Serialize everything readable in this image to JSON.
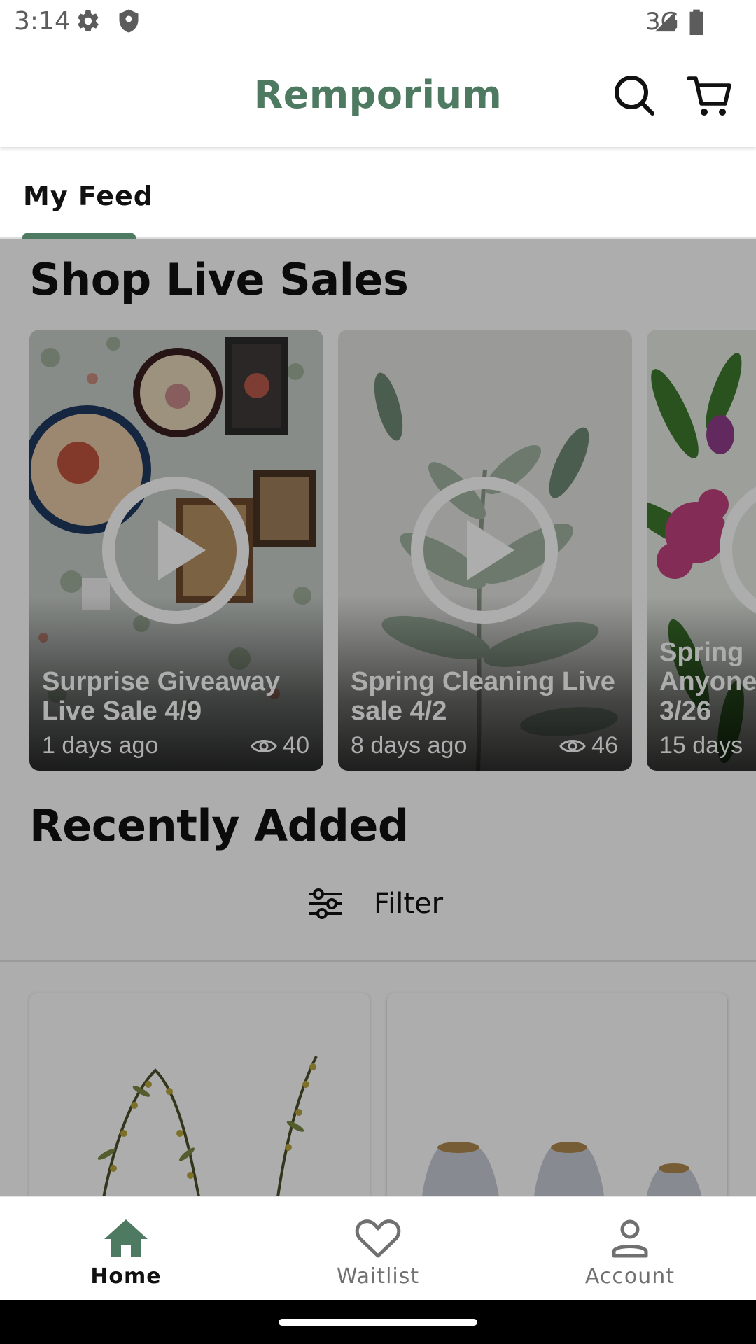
{
  "status_bar": {
    "time": "3:14",
    "network": "3G",
    "icons": [
      "settings-icon",
      "shield-icon",
      "signal-icon",
      "battery-icon"
    ]
  },
  "app_bar": {
    "title": "Remporium",
    "actions": [
      "search-icon",
      "cart-icon"
    ]
  },
  "tabs": [
    {
      "label": "My Feed",
      "selected": true
    }
  ],
  "sections": {
    "live_sales": {
      "title": "Shop Live Sales",
      "cards": [
        {
          "title": "Surprise Giveaway Live Sale 4/9",
          "age": "1 days ago",
          "views": "40"
        },
        {
          "title": "Spring Cleaning Live sale 4/2",
          "age": "8 days ago",
          "views": "46"
        },
        {
          "title": "Spring Anyone 3/26",
          "age": "15 days",
          "views": ""
        }
      ]
    },
    "recently_added": {
      "title": "Recently Added",
      "filter_label": "Filter"
    }
  },
  "bottom_nav": {
    "items": [
      {
        "label": "Home",
        "icon": "home-icon",
        "selected": true
      },
      {
        "label": "Waitlist",
        "icon": "heart-icon",
        "selected": false
      },
      {
        "label": "Account",
        "icon": "account-icon",
        "selected": false
      }
    ]
  },
  "colors": {
    "brand": "#4f7a62",
    "scrim": "rgba(0,0,0,0.32)",
    "nav_inactive": "#707070"
  }
}
